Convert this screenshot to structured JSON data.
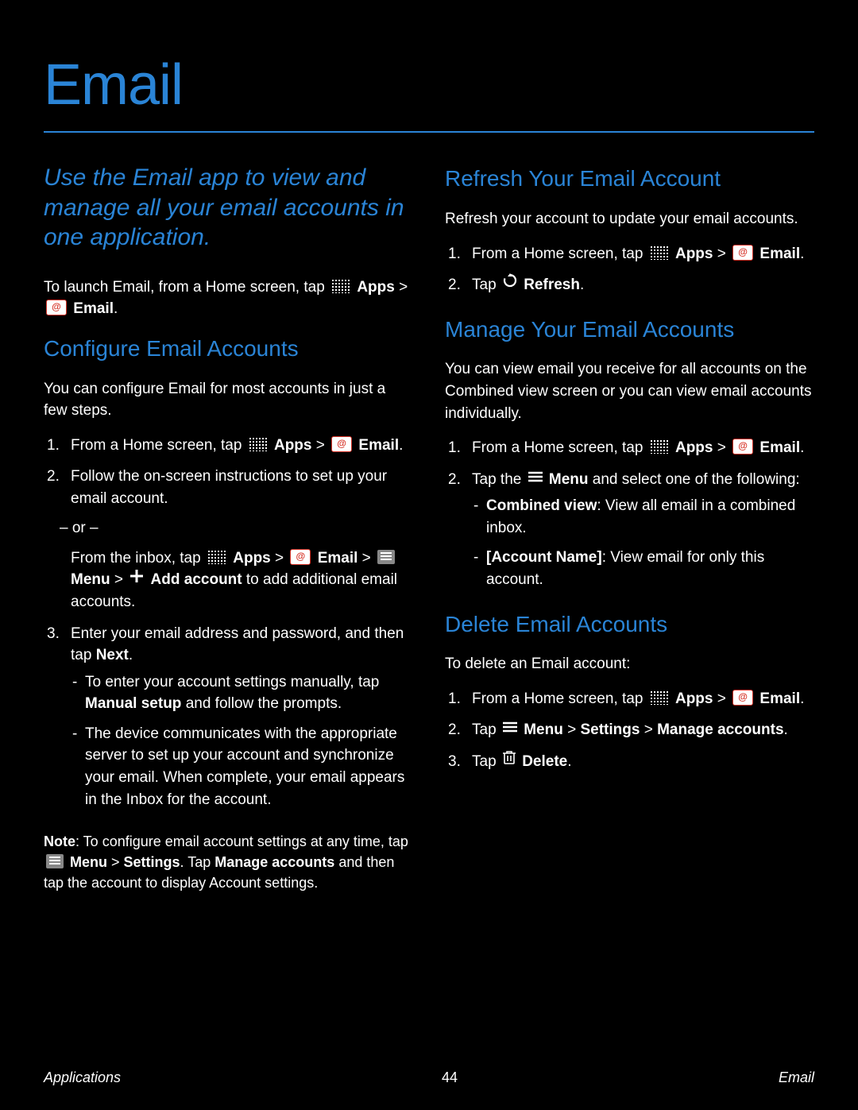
{
  "title": "Email",
  "intro": "Use the Email app to view and manage all your email accounts in one application.",
  "to_launch_pre": "To launch Email, from a Home screen, tap ",
  "apps_label": "Apps",
  "gt": " > ",
  "email_label": "Email",
  "period": ".",
  "left": {
    "heading": "Configure Email Accounts",
    "lead": "You can configure Email for most accounts in just a few steps.",
    "step1_pre": "From a Home screen, tap ",
    "step2": "Follow the on-screen instructions to set up your email account.",
    "or_tap": " – or –",
    "from_inbox_tap": "From the inbox, tap ",
    "menu_label": "Menu",
    "add_account_label": "Add account",
    "add_tail": " to add additional email accounts.",
    "step3": "Enter your email address and password, and then tap ",
    "next_label": "Next",
    "sub_a": "To enter your account settings manually, tap ",
    "manual_setup": "Manual setup",
    "sub_a_tail": " and follow the prompts.",
    "sub_b": "The device communicates with the appropriate server to set up your account and synchronize your email. When complete, your email appears in the Inbox for the account.",
    "note_pre": "Note",
    "note_body1": ": To configure email account settings at any time, tap ",
    "note_menu_path1": "Menu",
    "note_menu_path2": "Settings",
    "note_body2": ". Tap ",
    "note_manage": "Manage accounts",
    "note_tail": " and then tap the account to display Account settings."
  },
  "right": {
    "refresh_heading": "Refresh Your Email Account",
    "refresh_lead": "Refresh your account to update your email accounts.",
    "refresh_step1_pre": "From a Home screen, tap ",
    "refresh_step2_pre": "Tap ",
    "refresh_label": "Refresh",
    "manage_heading": "Manage Your Email Accounts",
    "manage_lead": "You can view email you receive for all accounts on the Combined view screen or you can view email accounts individually.",
    "manage_step1_pre": "From a Home screen, tap ",
    "manage_step2_pre": "Tap the ",
    "menu_word": "Menu",
    "manage_step2_tail": " and select one of the following:",
    "combined_label": "Combined view",
    "combined_tail": ": View all email in a combined inbox.",
    "account_name_label": "[Account Name]",
    "account_name_tail": ": View email for only this account.",
    "delete_heading": "Delete Email Accounts",
    "delete_lead": "To delete an Email account:",
    "delete_step1_pre": "From a Home screen, tap ",
    "delete_step2_pre": "Tap ",
    "settings_path": "Settings",
    "settings_path2": "Manage accounts",
    "delete_step3_pre": "Tap  ",
    "delete_label": "Delete"
  },
  "footer": {
    "left": "Applications",
    "center": "44",
    "right": "Email"
  }
}
